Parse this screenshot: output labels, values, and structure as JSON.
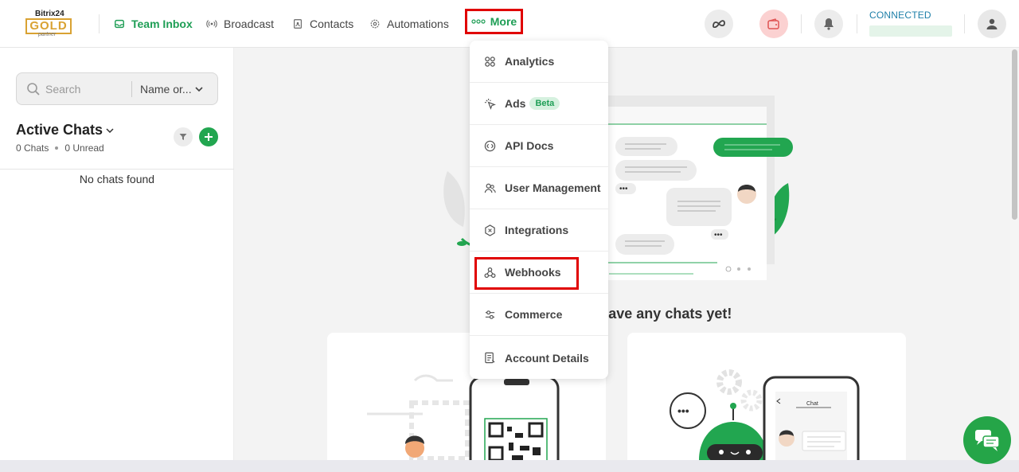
{
  "brand": {
    "line1": "Bitrix24",
    "badge": "GOLD",
    "line3": "partner"
  },
  "nav": {
    "team_inbox": "Team Inbox",
    "broadcast": "Broadcast",
    "contacts": "Contacts",
    "automations": "Automations",
    "more": "More"
  },
  "header": {
    "connection_status": "CONNECTED",
    "icons": [
      "meta-icon",
      "wallet-icon",
      "bell-icon",
      "user-icon"
    ]
  },
  "sidebar": {
    "search_placeholder": "Search",
    "sort_select": "Name or...",
    "title": "Active Chats",
    "chats_count": "0 Chats",
    "unread_count": "0 Unread",
    "empty_message": "No chats found"
  },
  "more_menu": {
    "items": [
      {
        "label": "Analytics",
        "icon": "analytics-icon"
      },
      {
        "label": "Ads",
        "icon": "ads-icon",
        "badge": "Beta"
      },
      {
        "label": "API Docs",
        "icon": "api-docs-icon"
      },
      {
        "label": "User Management",
        "icon": "users-icon"
      },
      {
        "label": "Integrations",
        "icon": "integrations-icon"
      },
      {
        "label": "Webhooks",
        "icon": "webhooks-icon"
      },
      {
        "label": "Commerce",
        "icon": "commerce-icon"
      },
      {
        "label": "Account Details",
        "icon": "account-details-icon"
      }
    ]
  },
  "main": {
    "empty_text": "n't have any chats yet!",
    "illustration_chat_label": "Chat"
  },
  "colors": {
    "brand_green": "#1e9e55",
    "highlight_red": "#e00000",
    "gold": "#d9a233"
  }
}
